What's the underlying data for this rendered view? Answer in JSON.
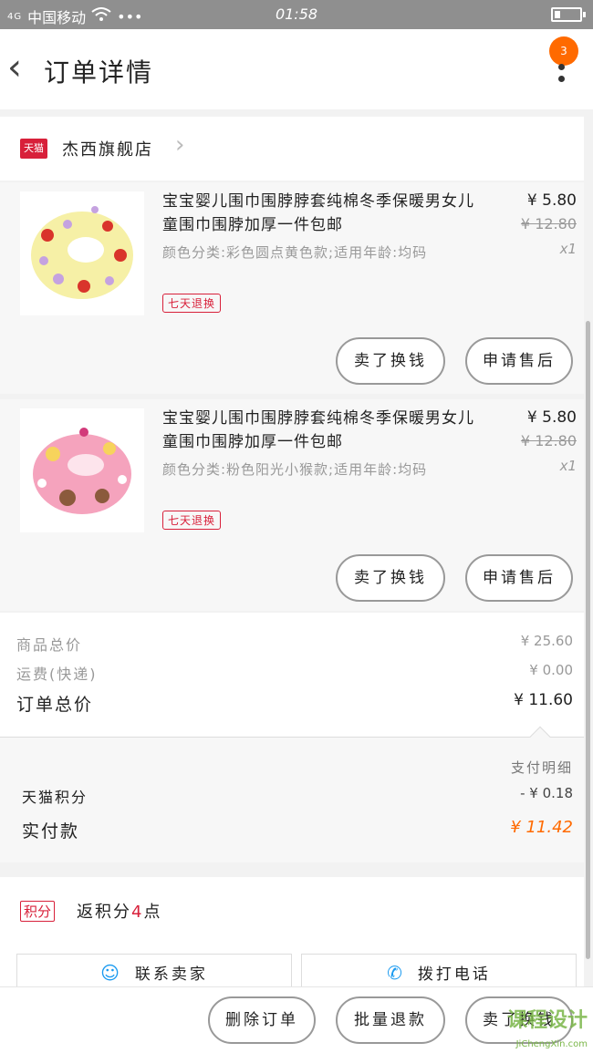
{
  "status_bar": {
    "signal": "4G",
    "carrier": "中国移动",
    "dots": "•••",
    "time": "01:58"
  },
  "header": {
    "back_icon": "‹",
    "title": "订单详情",
    "badge_count": "3"
  },
  "shop": {
    "platform_badge": "天猫",
    "name": "杰西旗舰店",
    "chevron": "›"
  },
  "items": [
    {
      "title": "宝宝婴儿围巾围脖脖套纯棉冬季保暖男女儿童围巾围脖加厚一件包邮",
      "spec": "颜色分类:彩色圆点黄色款;适用年龄:均码",
      "tag": "七天退换",
      "price": "¥ 5.80",
      "original_price": "¥ 12.80",
      "qty": "x1",
      "btn_left": "卖了换钱",
      "btn_right": "申请售后"
    },
    {
      "title": "宝宝婴儿围巾围脖脖套纯棉冬季保暖男女儿童围巾围脖加厚一件包邮",
      "spec": "颜色分类:粉色阳光小猴款;适用年龄:均码",
      "tag": "七天退换",
      "price": "¥ 5.80",
      "original_price": "¥ 12.80",
      "qty": "x1",
      "btn_left": "卖了换钱",
      "btn_right": "申请售后"
    }
  ],
  "totals": {
    "goods_label": "商品总价",
    "goods_value": "¥ 25.60",
    "shipping_label": "运费(快递)",
    "shipping_value": "¥ 0.00",
    "order_label": "订单总价",
    "order_value": "¥ 11.60"
  },
  "payment": {
    "detail_link": "支付明细",
    "points_label": "天猫积分",
    "points_value": "- ¥ 0.18",
    "paid_label": "实付款",
    "paid_value": "¥ 11.42"
  },
  "points": {
    "badge": "积分",
    "text_prefix": "返积分",
    "text_num": "4",
    "text_suffix": "点",
    "contact_seller": "联系卖家",
    "call_phone": "拨打电话"
  },
  "footer": {
    "delete": "删除订单",
    "batch_refund": "批量退款",
    "resell": "卖了换钱"
  },
  "watermark": {
    "logo": "课程设计",
    "site": "JiChengXin.com"
  },
  "colors": {
    "accent_orange": "#ff6a00",
    "tmall_red": "#d8203a",
    "status_bar": "#8f8f8f"
  }
}
